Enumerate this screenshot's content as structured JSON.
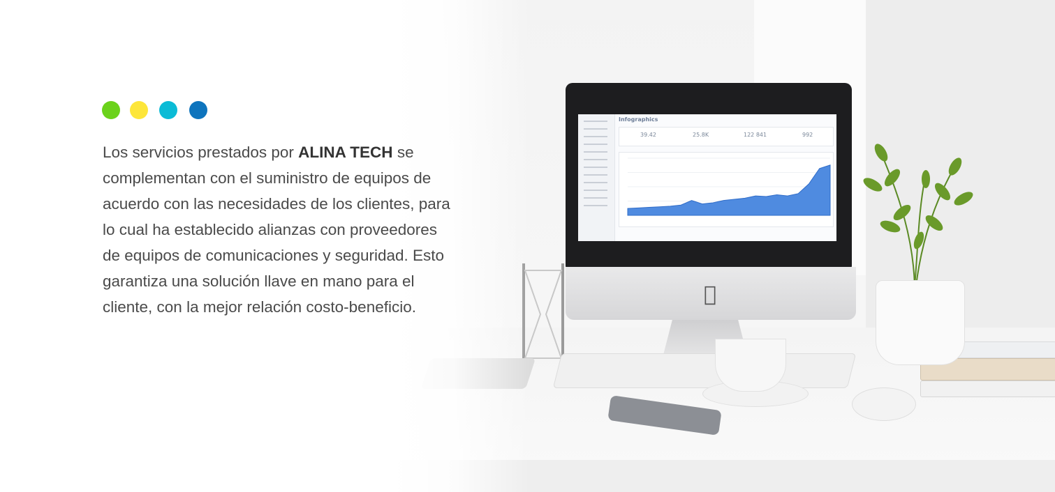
{
  "dots": {
    "colors": [
      "#6bd21b",
      "#fde63a",
      "#0bbbd6",
      "#0e74bd"
    ]
  },
  "intro": {
    "before": "Los servicios prestados por ",
    "company": "ALINA TECH",
    "after": " se complementan con el suministro de equipos de acuerdo con las necesidades de los clientes, para lo cual ha establecido alianzas con proveedores de equipos de comunicaciones y seguridad. Esto garantiza una solución llave en mano para el cliente, con la mejor relación costo-beneficio."
  },
  "screen": {
    "title": "Infographics",
    "stats": [
      "39.42",
      "25.8K",
      "122 841",
      "992"
    ]
  },
  "screen_chart": {
    "type": "area",
    "values": [
      12,
      13,
      14,
      15,
      16,
      18,
      26,
      20,
      22,
      26,
      28,
      30,
      34,
      33,
      36,
      34,
      38,
      55,
      82,
      88
    ],
    "ylim": [
      0,
      100
    ]
  }
}
